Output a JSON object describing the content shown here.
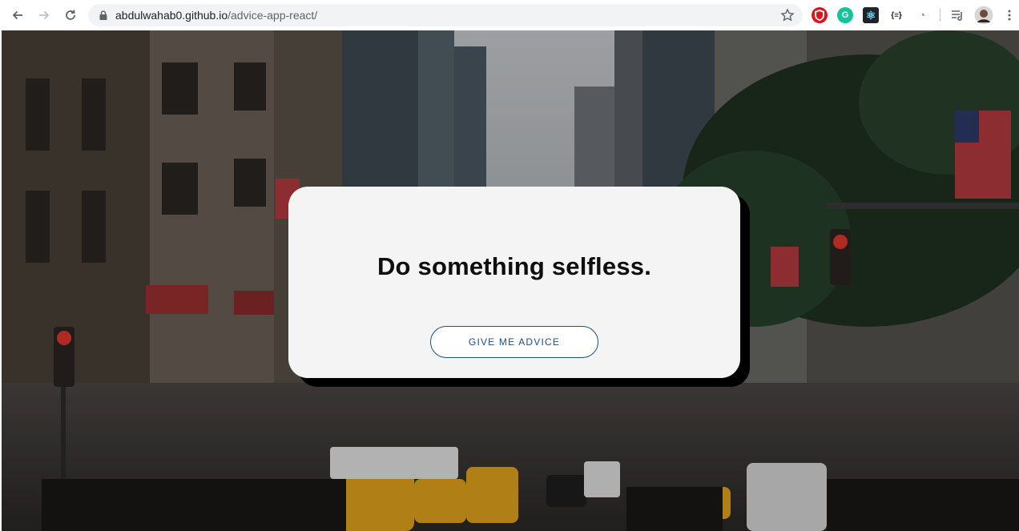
{
  "browser": {
    "url_domain": "abdulwahab0.github.io",
    "url_path": "/advice-app-react/",
    "extensions": [
      {
        "name": "ublock-extension-icon",
        "color": "#e0131b",
        "glyph": ""
      },
      {
        "name": "grammarly-extension-icon",
        "color": "#15c39a",
        "glyph": "G"
      },
      {
        "name": "react-devtools-extension-icon",
        "color": "#20232a",
        "glyph": "⚛"
      },
      {
        "name": "json-viewer-extension-icon",
        "color": "#ffffff",
        "glyph": "{≡}"
      },
      {
        "name": "other-extension-icon",
        "color": "#ffffff",
        "glyph": "◔"
      }
    ]
  },
  "card": {
    "advice": "Do something selfless.",
    "button_label": "GIVE ME ADVICE"
  },
  "colors": {
    "card_bg": "#f4f4f4",
    "button_accent": "#1c4f8a",
    "shadow": "#000000"
  }
}
